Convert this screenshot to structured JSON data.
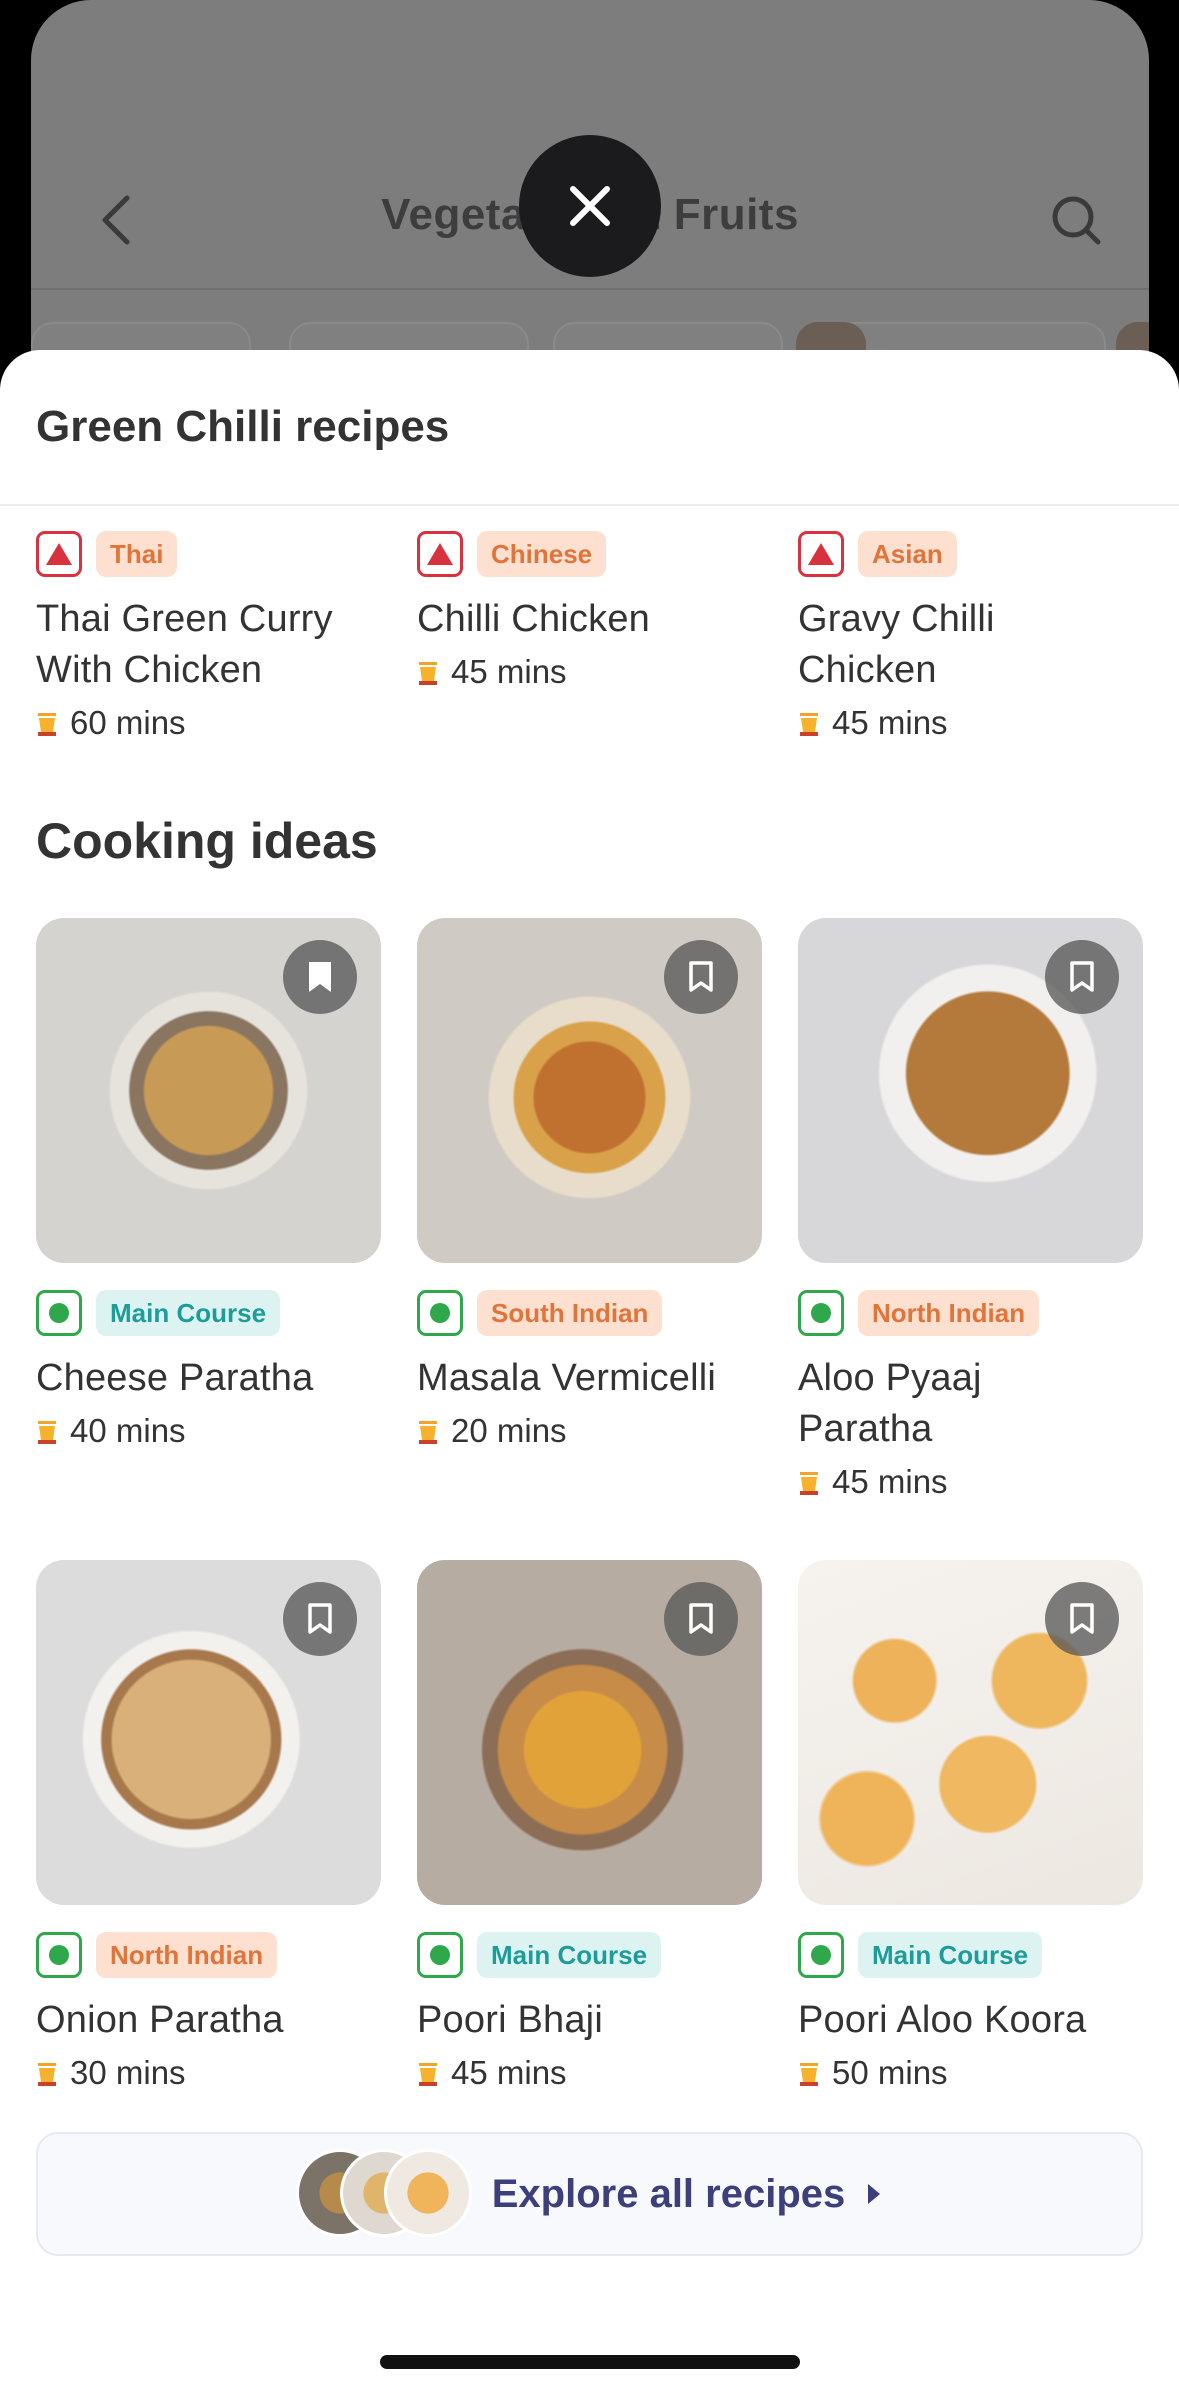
{
  "background_screen": {
    "title": "Vegetables & Fruits"
  },
  "sheet": {
    "title": "Green Chilli recipes"
  },
  "top_recipes": [
    {
      "cuisine": "Thai",
      "name": "Thai Green Curry With Chicken",
      "time": "60 mins",
      "diet": "non-veg"
    },
    {
      "cuisine": "Chinese",
      "name": "Chilli Chicken",
      "time": "45 mins",
      "diet": "non-veg"
    },
    {
      "cuisine": "Asian",
      "name": "Gravy Chilli Chicken",
      "time": "45 mins",
      "diet": "non-veg"
    }
  ],
  "cooking_ideas": {
    "title": "Cooking ideas",
    "items": [
      {
        "tag": "Main Course",
        "tag_color": "teal",
        "name": "Cheese Paratha",
        "time": "40 mins",
        "diet": "veg",
        "bookmarked": true
      },
      {
        "tag": "South Indian",
        "tag_color": "orange",
        "name": "Masala Vermicelli",
        "time": "20 mins",
        "diet": "veg",
        "bookmarked": false
      },
      {
        "tag": "North Indian",
        "tag_color": "orange",
        "name": "Aloo Pyaaj Paratha",
        "time": "45 mins",
        "diet": "veg",
        "bookmarked": false
      },
      {
        "tag": "North Indian",
        "tag_color": "orange",
        "name": "Onion Paratha",
        "time": "30 mins",
        "diet": "veg",
        "bookmarked": false
      },
      {
        "tag": "Main Course",
        "tag_color": "teal",
        "name": "Poori Bhaji",
        "time": "45 mins",
        "diet": "veg",
        "bookmarked": false
      },
      {
        "tag": "Main Course",
        "tag_color": "teal",
        "name": "Poori Aloo Koora",
        "time": "50 mins",
        "diet": "veg",
        "bookmarked": false
      }
    ]
  },
  "explore": {
    "label": "Explore all recipes"
  },
  "colors": {
    "veg": "#2ea84a",
    "nonveg": "#d8323f",
    "orange_tag_bg": "#fde0cf",
    "orange_tag_text": "#e0743b",
    "teal_tag_bg": "#ddf3f1",
    "teal_tag_text": "#1d9c9a",
    "explore_text": "#3c3f7a"
  }
}
